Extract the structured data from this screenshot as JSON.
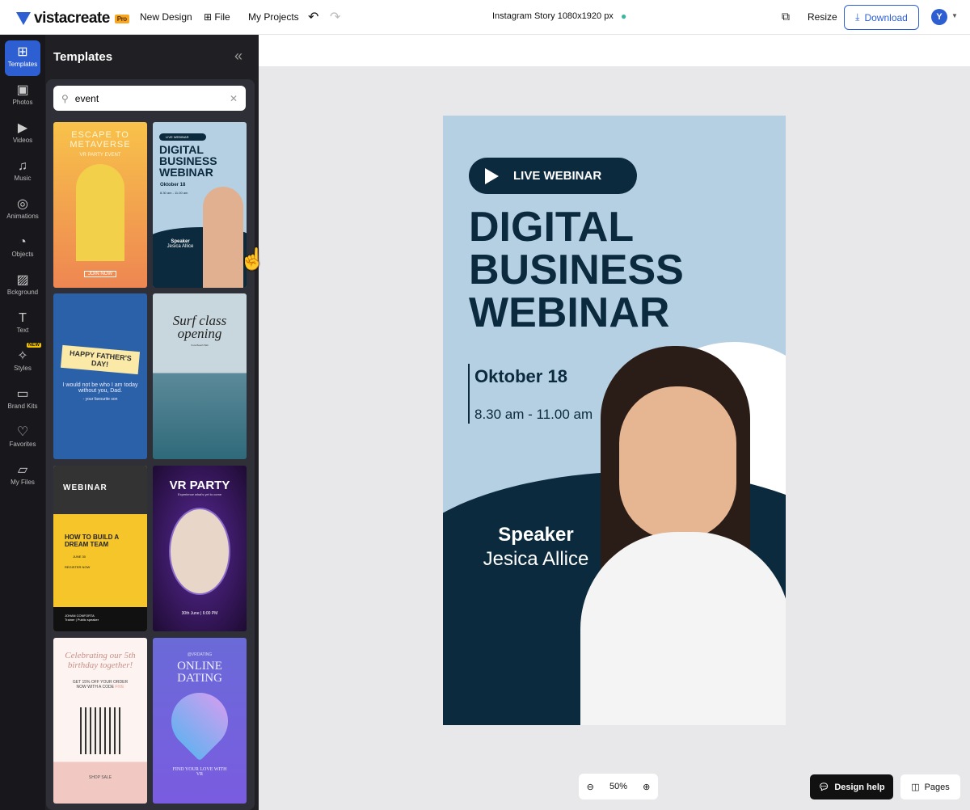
{
  "header": {
    "brand": "vistacreate",
    "pro_badge": "Pro",
    "new_design": "New Design",
    "file": "File",
    "my_projects": "My Projects",
    "doc_title": "Instagram Story 1080x1920 px",
    "resize": "Resize",
    "download": "Download",
    "avatar_initial": "Y"
  },
  "rail": {
    "items": [
      {
        "label": "Templates",
        "icon": "grid-icon"
      },
      {
        "label": "Photos",
        "icon": "image-icon"
      },
      {
        "label": "Videos",
        "icon": "play-icon"
      },
      {
        "label": "Music",
        "icon": "music-icon"
      },
      {
        "label": "Animations",
        "icon": "animation-icon"
      },
      {
        "label": "Objects",
        "icon": "shapes-icon"
      },
      {
        "label": "Bckground",
        "icon": "stripes-icon"
      },
      {
        "label": "Text",
        "icon": "text-icon"
      },
      {
        "label": "Styles",
        "icon": "sparkle-icon",
        "badge": "NEW"
      },
      {
        "label": "Brand Kits",
        "icon": "briefcase-icon"
      },
      {
        "label": "Favorites",
        "icon": "heart-icon"
      },
      {
        "label": "My Files",
        "icon": "folder-icon"
      }
    ]
  },
  "panel": {
    "title": "Templates",
    "search_value": "event",
    "templates": [
      {
        "title": "ESCAPE TO METAVERSE",
        "sub": "VR PARTY EVENT",
        "cta": "JOIN NOW"
      },
      {
        "badge": "LIVE WEBINAR",
        "title": "DIGITAL BUSINESS WEBINAR",
        "date": "Oktober 18",
        "time": "8.30 am - 11.00 am",
        "speaker": "Speaker",
        "name": "Jesica Allice"
      },
      {
        "title": "HAPPY FATHER'S DAY!",
        "body": "I would not be who I am today without you, Dad.",
        "sign": "- your favourite son"
      },
      {
        "title": "Surf class opening",
        "sub": "Kuta Beach Bali"
      },
      {
        "label": "WEBINAR",
        "title": "HOW TO BUILD A DREAM TEAM",
        "date": "JUNE 30",
        "cta": "REGISTER NOW",
        "name": "JOHAN CONFORTA",
        "role": "Trainer | Public speaker"
      },
      {
        "title": "VR PARTY",
        "sub": "Experience what's yet to come",
        "date": "30th June | 6:00 PM"
      },
      {
        "title": "Celebrating our 5th birthday together!",
        "body": "GET 15% OFF YOUR ORDER NOW WITH A CODE",
        "code": "FIVE",
        "cta": "SHOP SALE"
      },
      {
        "handle": "@VRDATING",
        "title": "ONLINE DATING",
        "cta": "FIND YOUR LOVE WITH VR"
      }
    ]
  },
  "design": {
    "badge": "LIVE WEBINAR",
    "headline": [
      "DIGITAL",
      "BUSINESS",
      "WEBINAR"
    ],
    "date": "Oktober 18",
    "time": "8.30 am - 11.00 am",
    "speaker": "Speaker",
    "name": "Jesica Allice"
  },
  "footer": {
    "zoom": "50%",
    "design_help": "Design help",
    "pages": "Pages"
  },
  "colors": {
    "accent": "#2d5fd3",
    "navy": "#0b2a3d",
    "sky": "#b5cfe3"
  }
}
